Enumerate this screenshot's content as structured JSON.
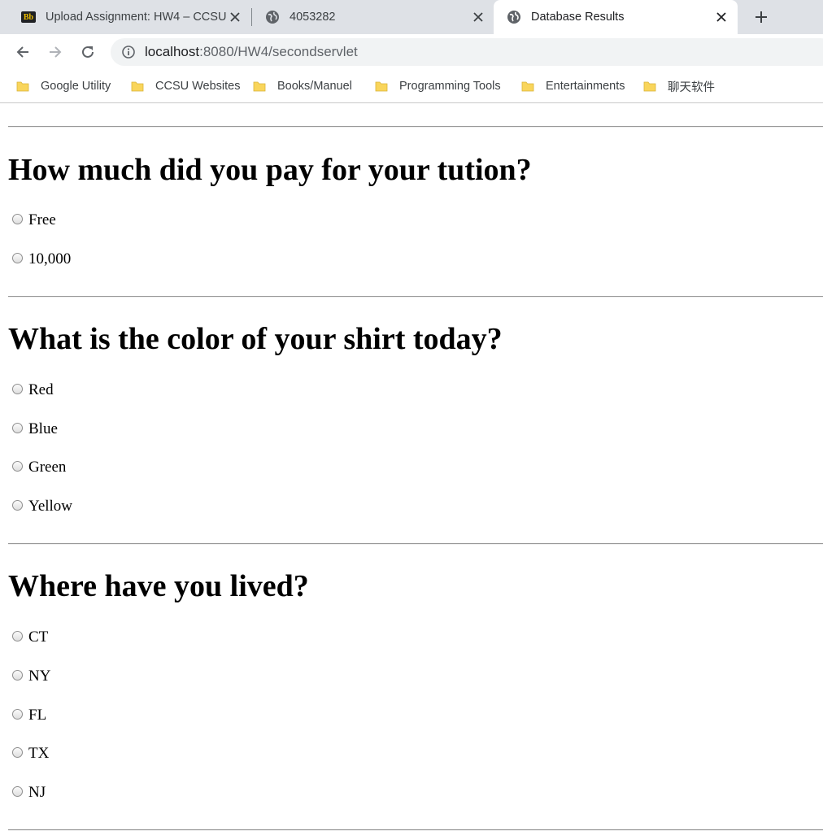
{
  "browser": {
    "tabs": [
      {
        "title": "Upload Assignment: HW4 – CCSU",
        "favicon": "blackboard-icon",
        "active": false
      },
      {
        "title": "4053282",
        "favicon": "globe-icon",
        "active": false
      },
      {
        "title": "Database Results",
        "favicon": "globe-icon",
        "active": true
      }
    ],
    "favicon_text": {
      "b1": "B",
      "b2": "b"
    },
    "url": {
      "host": "localhost",
      "rest": ":8080/HW4/secondservlet"
    },
    "bookmarks": [
      "Google Utility",
      "CCSU Websites",
      "Books/Manuel",
      "Programming Tools",
      "Entertainments",
      "聊天软件"
    ]
  },
  "questions": [
    {
      "title": "How much did you pay for your tution?",
      "options": [
        "Free",
        "10,000"
      ]
    },
    {
      "title": "What is the color of your shirt today?",
      "options": [
        "Red",
        "Blue",
        "Green",
        "Yellow"
      ]
    },
    {
      "title": "Where have you lived?",
      "options": [
        "CT",
        "NY",
        "FL",
        "TX",
        "NJ"
      ]
    }
  ],
  "colors": {
    "tabstrip": "#dee1e6",
    "folder": "#f9d55b",
    "text": "#000000"
  }
}
